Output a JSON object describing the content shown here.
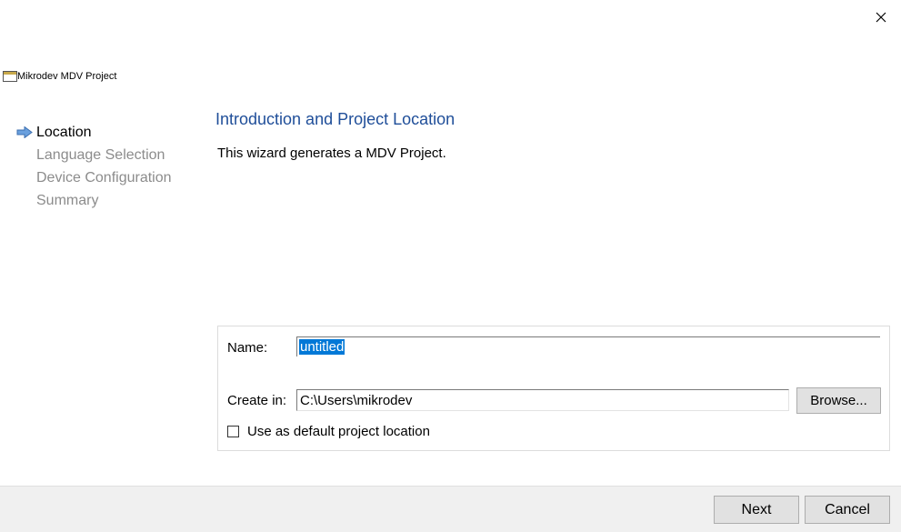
{
  "window": {
    "title": "Mikrodev MDV Project",
    "close_icon": "close-icon",
    "app_icon": "window-icon"
  },
  "steps": [
    {
      "label": "Location",
      "active": true
    },
    {
      "label": "Language Selection",
      "active": false
    },
    {
      "label": "Device Configuration",
      "active": false
    },
    {
      "label": "Summary",
      "active": false
    }
  ],
  "page": {
    "heading": "Introduction and Project Location",
    "description": "This wizard generates a MDV Project."
  },
  "form": {
    "name_label": "Name:",
    "name_value": "untitled",
    "create_in_label": "Create in:",
    "create_in_value": "C:\\Users\\mikrodev",
    "browse_label": "Browse...",
    "default_location_label": "Use as default project location",
    "default_location_checked": false
  },
  "footer": {
    "next_label": "Next",
    "cancel_label": "Cancel"
  },
  "colors": {
    "heading": "#1f4e99",
    "selection": "#0078d7",
    "inactive_step": "#8c8c8c",
    "footer_bg": "#f0f0f0"
  }
}
